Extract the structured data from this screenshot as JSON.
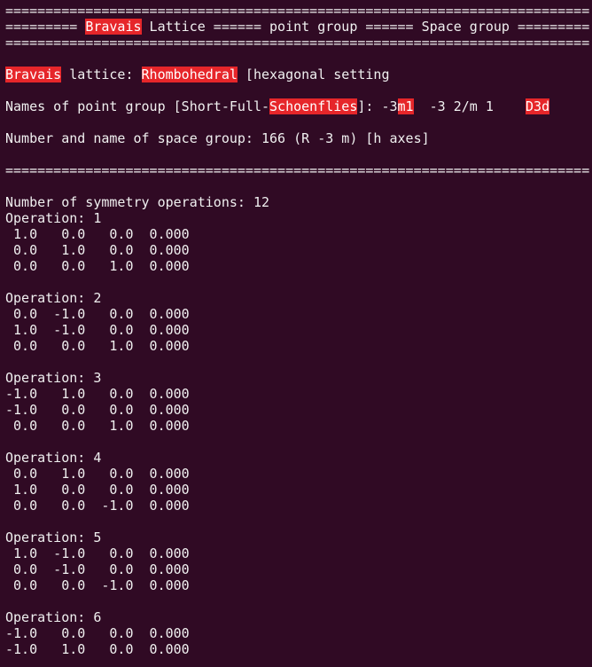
{
  "window": {
    "type": "terminal"
  },
  "colors": {
    "background": "#300a24",
    "text": "#f0f0f0",
    "highlight": "#e6262a"
  },
  "lines": [
    [
      {
        "t": "========================================================================="
      }
    ],
    [
      {
        "t": "========= "
      },
      {
        "t": "Bravais",
        "hl": true
      },
      {
        "t": " Lattice ====== point group ====== Space group ========="
      }
    ],
    [
      {
        "t": "========================================================================="
      }
    ],
    [],
    [
      {
        "t": "Bravais",
        "hl": true
      },
      {
        "t": " lattice: "
      },
      {
        "t": "Rhombohedral",
        "hl": true
      },
      {
        "t": " [hexagonal setting"
      }
    ],
    [],
    [
      {
        "t": "Names of point group [Short-Full-"
      },
      {
        "t": "Schoenflies",
        "hl": true
      },
      {
        "t": "]: -3"
      },
      {
        "t": "m1",
        "hl": true
      },
      {
        "t": "  -3 2/m 1    "
      },
      {
        "t": "D3d",
        "hl": true
      }
    ],
    [],
    [
      {
        "t": "Number and name of space group: 166 (R -3 m) [h axes]"
      }
    ],
    [],
    [
      {
        "t": "========================================================================="
      }
    ],
    [],
    [
      {
        "t": "Number of symmetry operations: 12"
      }
    ],
    [
      {
        "t": "Operation: 1"
      }
    ],
    [
      {
        "t": " 1.0   0.0   0.0  0.000"
      }
    ],
    [
      {
        "t": " 0.0   1.0   0.0  0.000"
      }
    ],
    [
      {
        "t": " 0.0   0.0   1.0  0.000"
      }
    ],
    [],
    [
      {
        "t": "Operation: 2"
      }
    ],
    [
      {
        "t": " 0.0  -1.0   0.0  0.000"
      }
    ],
    [
      {
        "t": " 1.0  -1.0   0.0  0.000"
      }
    ],
    [
      {
        "t": " 0.0   0.0   1.0  0.000"
      }
    ],
    [],
    [
      {
        "t": "Operation: 3"
      }
    ],
    [
      {
        "t": "-1.0   1.0   0.0  0.000"
      }
    ],
    [
      {
        "t": "-1.0   0.0   0.0  0.000"
      }
    ],
    [
      {
        "t": " 0.0   0.0   1.0  0.000"
      }
    ],
    [],
    [
      {
        "t": "Operation: 4"
      }
    ],
    [
      {
        "t": " 0.0   1.0   0.0  0.000"
      }
    ],
    [
      {
        "t": " 1.0   0.0   0.0  0.000"
      }
    ],
    [
      {
        "t": " 0.0   0.0  -1.0  0.000"
      }
    ],
    [],
    [
      {
        "t": "Operation: 5"
      }
    ],
    [
      {
        "t": " 1.0  -1.0   0.0  0.000"
      }
    ],
    [
      {
        "t": " 0.0  -1.0   0.0  0.000"
      }
    ],
    [
      {
        "t": " 0.0   0.0  -1.0  0.000"
      }
    ],
    [],
    [
      {
        "t": "Operation: 6"
      }
    ],
    [
      {
        "t": "-1.0   0.0   0.0  0.000"
      }
    ],
    [
      {
        "t": "-1.0   1.0   0.0  0.000"
      }
    ]
  ]
}
